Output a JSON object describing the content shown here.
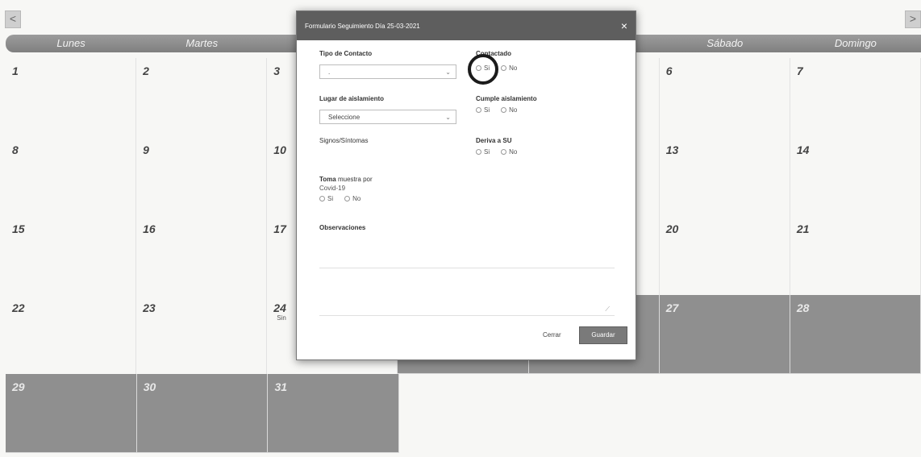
{
  "nav": {
    "prev_icon": "<",
    "next_icon": ">"
  },
  "calendar": {
    "days_of_week": [
      "Lunes",
      "Martes",
      "",
      "",
      "",
      "Sábado",
      "Domingo"
    ],
    "weeks": [
      [
        "1",
        "2",
        "3",
        "",
        "",
        "6",
        "7"
      ],
      [
        "8",
        "9",
        "10",
        "",
        "",
        "13",
        "14"
      ],
      [
        "15",
        "16",
        "17",
        "",
        "",
        "20",
        "21"
      ],
      [
        "22",
        "23",
        "24",
        "",
        "",
        "27",
        "28"
      ],
      [
        "29",
        "30",
        "31",
        "",
        "",
        "",
        ""
      ]
    ],
    "note_24": "Sin"
  },
  "modal": {
    "title": "Formulario Seguimiento Día 25-03-2021",
    "close_icon": "×",
    "tipo_contacto": {
      "label": "Tipo de Contacto",
      "value": "."
    },
    "contactado": {
      "label": "Contactado",
      "yes": "Si",
      "no": "No"
    },
    "lugar": {
      "label": "Lugar de aislamiento",
      "value": "Seleccione"
    },
    "cumple": {
      "label": "Cumple aislamiento",
      "yes": "Si",
      "no": "No"
    },
    "signos": {
      "label": "Signos/Síntomas"
    },
    "deriva": {
      "label": "Deriva a SU",
      "yes": "Si",
      "no": "No"
    },
    "toma": {
      "label_bold": "Toma",
      "label_rest": "muestra por",
      "label_line2": "Covid-19",
      "yes": "Si",
      "no": "No"
    },
    "observaciones": {
      "label": "Observaciones"
    },
    "buttons": {
      "close": "Cerrar",
      "save": "Guardar"
    }
  },
  "colors": {
    "header": "#8c8c8c",
    "shaded_day": "#8f8f8f",
    "modal_header": "#5e5e5e",
    "save_button": "#7a7a7a"
  }
}
